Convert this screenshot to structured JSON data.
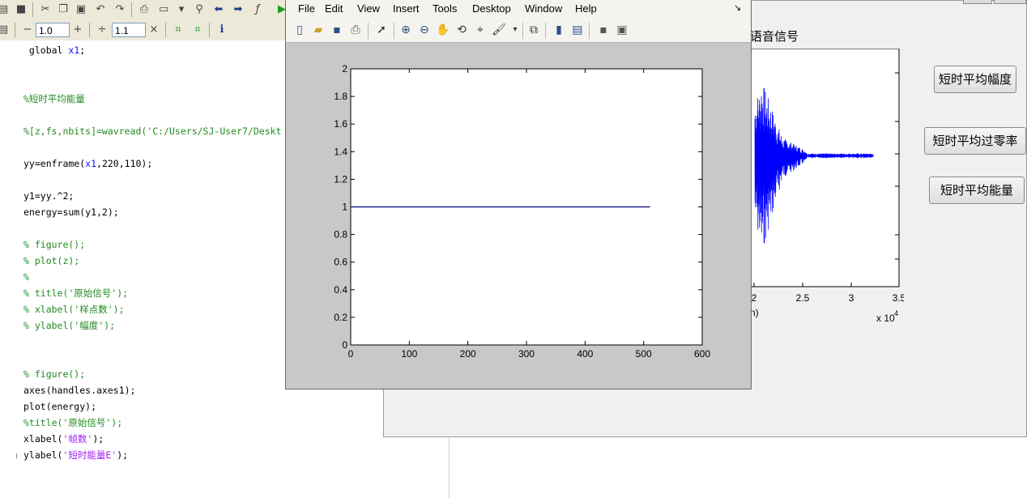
{
  "editor": {
    "toolbar2": {
      "minus": "−",
      "cell_value_1": "1.0",
      "plus": "+",
      "divide": "÷",
      "cell_value_2": "1.1",
      "times": "×"
    },
    "code_lines": [
      {
        "y": 62,
        "segments": [
          {
            "t": " global ",
            "c": "black"
          },
          {
            "t": "x1",
            "c": "blue"
          },
          {
            "t": ";",
            "c": "black"
          }
        ]
      },
      {
        "y": 122,
        "segments": [
          {
            "t": "%短时平均能量",
            "c": "green"
          }
        ]
      },
      {
        "y": 162,
        "segments": [
          {
            "t": "%[z,fs,nbits]=wavread('C:/Users/SJ-User7/Deskt",
            "c": "green"
          }
        ]
      },
      {
        "y": 202,
        "segments": [
          {
            "t": "yy=enframe(",
            "c": "black"
          },
          {
            "t": "x1",
            "c": "blue"
          },
          {
            "t": ",220,110);",
            "c": "black"
          }
        ]
      },
      {
        "y": 242,
        "segments": [
          {
            "t": "y1=yy.^2;",
            "c": "black"
          }
        ]
      },
      {
        "y": 262,
        "segments": [
          {
            "t": "energy=sum(y1,2);",
            "c": "black"
          }
        ]
      },
      {
        "y": 302,
        "segments": [
          {
            "t": "% figure();",
            "c": "green"
          }
        ]
      },
      {
        "y": 322,
        "segments": [
          {
            "t": "% plot(z);",
            "c": "green"
          }
        ]
      },
      {
        "y": 342,
        "segments": [
          {
            "t": "%",
            "c": "green"
          }
        ]
      },
      {
        "y": 362,
        "segments": [
          {
            "t": "% title('原始信号');",
            "c": "green"
          }
        ]
      },
      {
        "y": 382,
        "segments": [
          {
            "t": "% xlabel('样点数');",
            "c": "green"
          }
        ]
      },
      {
        "y": 402,
        "segments": [
          {
            "t": "% ylabel('幅度');",
            "c": "green"
          }
        ]
      },
      {
        "y": 462,
        "segments": [
          {
            "t": "% figure();",
            "c": "green"
          }
        ]
      },
      {
        "y": 482,
        "segments": [
          {
            "t": "axes(handles.axes1);",
            "c": "black"
          }
        ]
      },
      {
        "y": 502,
        "segments": [
          {
            "t": "plot(energy);",
            "c": "black"
          }
        ]
      },
      {
        "y": 522,
        "segments": [
          {
            "t": "%title('原始信号');",
            "c": "green"
          }
        ]
      },
      {
        "y": 542,
        "segments": [
          {
            "t": "xlabel(",
            "c": "black"
          },
          {
            "t": "'帧数'",
            "c": "purple"
          },
          {
            "t": ");",
            "c": "black"
          }
        ]
      },
      {
        "y": 562,
        "segments": [
          {
            "t": "ylabel(",
            "c": "black"
          },
          {
            "t": "'短时能量E'",
            "c": "purple"
          },
          {
            "t": ");",
            "c": "black"
          }
        ]
      }
    ]
  },
  "gui": {
    "panel_title": "语音信号",
    "buttons": {
      "amplitude": "短时平均幅度",
      "zero_crossing": "短时平均过零率",
      "energy": "短时平均能量"
    },
    "axes_partial": {
      "tick_labels": [
        "2",
        "2.5",
        "3",
        "3.5"
      ],
      "xlabel_fragment": "n)",
      "exponent_label": "x 10",
      "exponent_power": "4"
    }
  },
  "figure": {
    "menu": [
      "File",
      "Edit",
      "View",
      "Insert",
      "Tools",
      "Desktop",
      "Window",
      "Help"
    ],
    "dock_arrow": "↘"
  },
  "chart_data": [
    {
      "type": "line",
      "title": "",
      "xlabel": "",
      "ylabel": "",
      "xlim": [
        0,
        600
      ],
      "ylim": [
        0,
        2
      ],
      "xticks": [
        0,
        100,
        200,
        300,
        400,
        500,
        600
      ],
      "yticks": [
        0,
        0.2,
        0.4,
        0.6,
        0.8,
        1,
        1.2,
        1.4,
        1.6,
        1.8,
        2
      ],
      "grid": false,
      "series": [
        {
          "x": [
            1,
            511
          ],
          "y": [
            1,
            1
          ],
          "color": "#00007f"
        }
      ]
    },
    {
      "type": "line",
      "title": "",
      "xlabel": "",
      "ylabel": "",
      "x_visible_range": [
        2,
        3.5
      ],
      "xticks_visible": [
        2,
        2.5,
        3,
        3.5
      ],
      "x_multiplier": "x 10^4",
      "series": [
        {
          "description_color": "#0000ff"
        }
      ]
    }
  ]
}
